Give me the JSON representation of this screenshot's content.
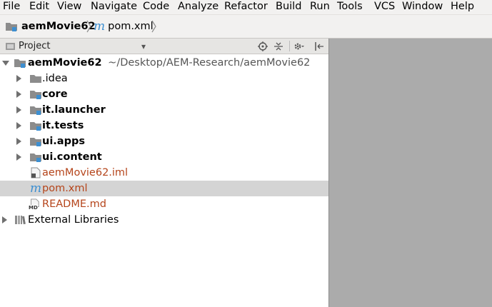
{
  "menu": [
    "File",
    "Edit",
    "View",
    "Navigate",
    "Code",
    "Analyze",
    "Refactor",
    "Build",
    "Run",
    "Tools",
    "VCS",
    "Window",
    "Help"
  ],
  "breadcrumb": {
    "project": "aemMovie62",
    "file": "pom.xml",
    "file_icon_glyph": "m"
  },
  "project_panel": {
    "title": "Project",
    "dropdown_glyph": "▾",
    "header_icons": [
      "locate-icon",
      "collapse-all-icon",
      "gear-icon",
      "hide-panel-icon"
    ]
  },
  "tree": {
    "root": {
      "name": "aemMovie62",
      "path": "~/Desktop/AEM-Research/aemMovie62"
    },
    "items": [
      {
        "label": ".idea",
        "type": "folder"
      },
      {
        "label": "core",
        "type": "module"
      },
      {
        "label": "it.launcher",
        "type": "module"
      },
      {
        "label": "it.tests",
        "type": "module"
      },
      {
        "label": "ui.apps",
        "type": "module"
      },
      {
        "label": "ui.content",
        "type": "module"
      },
      {
        "label": "aemMovie62.iml",
        "type": "iml-file"
      },
      {
        "label": "pom.xml",
        "type": "maven-file",
        "selected": true
      },
      {
        "label": "README.md",
        "type": "md-file",
        "badge": "MD"
      }
    ],
    "external": "External Libraries"
  },
  "colors": {
    "accent": "#3d8fd1",
    "selection": "#d4d4d4",
    "editor_bg": "#ababab",
    "modified_file": "#b5451b"
  }
}
